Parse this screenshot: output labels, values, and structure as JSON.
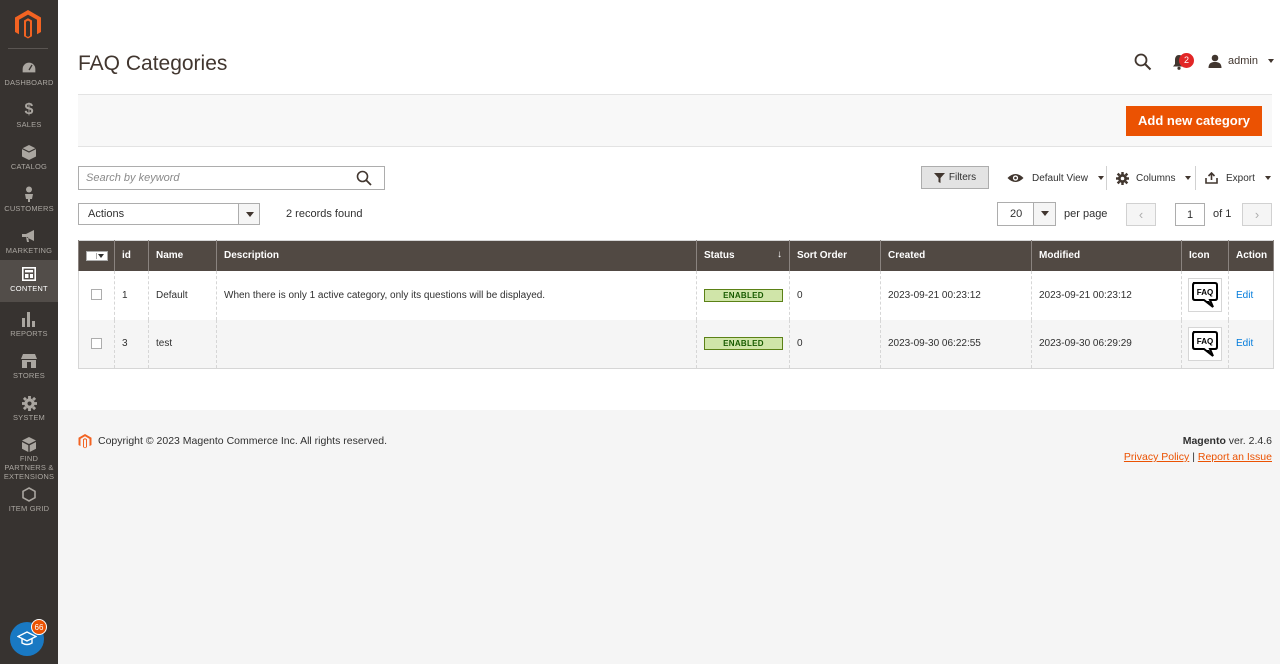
{
  "sidebar": {
    "items": [
      {
        "label": "DASHBOARD",
        "icon": "dashboard-icon"
      },
      {
        "label": "SALES",
        "icon": "dollar-icon"
      },
      {
        "label": "CATALOG",
        "icon": "cube-icon"
      },
      {
        "label": "CUSTOMERS",
        "icon": "person-icon"
      },
      {
        "label": "MARKETING",
        "icon": "megaphone-icon"
      },
      {
        "label": "CONTENT",
        "icon": "layout-icon",
        "active": true
      },
      {
        "label": "REPORTS",
        "icon": "bar-chart-icon"
      },
      {
        "label": "STORES",
        "icon": "storefront-icon"
      },
      {
        "label": "SYSTEM",
        "icon": "gear-icon"
      },
      {
        "label": "FIND PARTNERS & EXTENSIONS",
        "icon": "boxes-icon"
      },
      {
        "label": "ITEM GRID",
        "icon": "hexagon-icon"
      }
    ],
    "help_badge": "66"
  },
  "header": {
    "title": "FAQ Categories",
    "notifications_count": "2",
    "user": "admin"
  },
  "actionbar": {
    "primary_button": "Add new category"
  },
  "toolbar": {
    "search_placeholder": "Search by keyword",
    "filters": "Filters",
    "view": "Default View",
    "columns": "Columns",
    "export": "Export",
    "actions": "Actions",
    "records_found": "2 records found",
    "per_page_value": "20",
    "per_page_label": "per page",
    "current_page": "1",
    "of_pages": "of 1"
  },
  "grid": {
    "columns": [
      "id",
      "Name",
      "Description",
      "Status",
      "Sort Order",
      "Created",
      "Modified",
      "Icon",
      "Action"
    ],
    "rows": [
      {
        "id": "1",
        "name": "Default",
        "description": "When there is only 1 active category, only its questions will be displayed.",
        "status": "ENABLED",
        "sort_order": "0",
        "created": "2023-09-21 00:23:12",
        "modified": "2023-09-21 00:23:12",
        "icon": "faq-chat-icon",
        "action": "Edit"
      },
      {
        "id": "3",
        "name": "test",
        "description": "",
        "status": "ENABLED",
        "sort_order": "0",
        "created": "2023-09-30 06:22:55",
        "modified": "2023-09-30 06:29:29",
        "icon": "faq-chat-icon",
        "action": "Edit"
      }
    ]
  },
  "footer": {
    "copyright": "Copyright © 2023 Magento Commerce Inc. All rights reserved.",
    "brand": "Magento",
    "version": " ver. 2.4.6",
    "privacy": "Privacy Policy",
    "separator": "|",
    "report": "Report an Issue"
  },
  "colors": {
    "sidebar_bg": "#373330",
    "accent": "#eb5202",
    "grid_header": "#514943",
    "status_bg": "#d0e5a9",
    "link": "#007bdb"
  }
}
